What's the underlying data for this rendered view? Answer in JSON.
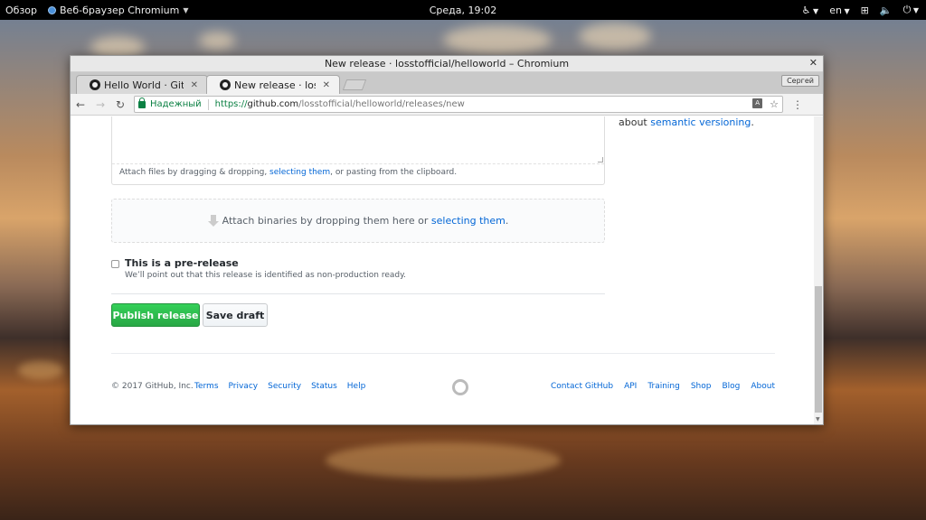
{
  "topbar": {
    "activities": "Обзор",
    "app_name": "Веб-браузер Chromium",
    "clock": "Среда, 19:02",
    "lang": "en"
  },
  "window": {
    "title": "New release · losstofficial/helloworld – Chromium",
    "tabs": [
      {
        "label": "Hello World · GitHub",
        "active": false
      },
      {
        "label": "New release · losstofficial/helloworld",
        "active": true
      }
    ],
    "profile_label": "Сергей"
  },
  "omnibox": {
    "secure_label": "Надежный",
    "scheme": "https://",
    "host": "github.com",
    "path": "/losstofficial/helloworld/releases/new"
  },
  "sidebar": {
    "about_prefix": "about ",
    "semver_link": "semantic versioning",
    "about_suffix": "."
  },
  "form": {
    "attach_files_prefix": "Attach files by dragging & dropping, ",
    "attach_files_link": "selecting them",
    "attach_files_suffix": ", or pasting from the clipboard.",
    "binaries_prefix": "Attach binaries by dropping them here or ",
    "binaries_link": "selecting them",
    "binaries_suffix": ".",
    "prerelease_title": "This is a pre-release",
    "prerelease_note": "We’ll point out that this release is identified as non-production ready.",
    "prerelease_checked": false,
    "publish_label": "Publish release",
    "draft_label": "Save draft"
  },
  "footer": {
    "copyright": "© 2017 GitHub, Inc.",
    "left_links": [
      "Terms",
      "Privacy",
      "Security",
      "Status",
      "Help"
    ],
    "right_links": [
      "Contact GitHub",
      "API",
      "Training",
      "Shop",
      "Blog",
      "About"
    ]
  },
  "colors": {
    "link": "#0366d6",
    "publish_green": "#28a745",
    "secure_green": "#0b8043"
  }
}
